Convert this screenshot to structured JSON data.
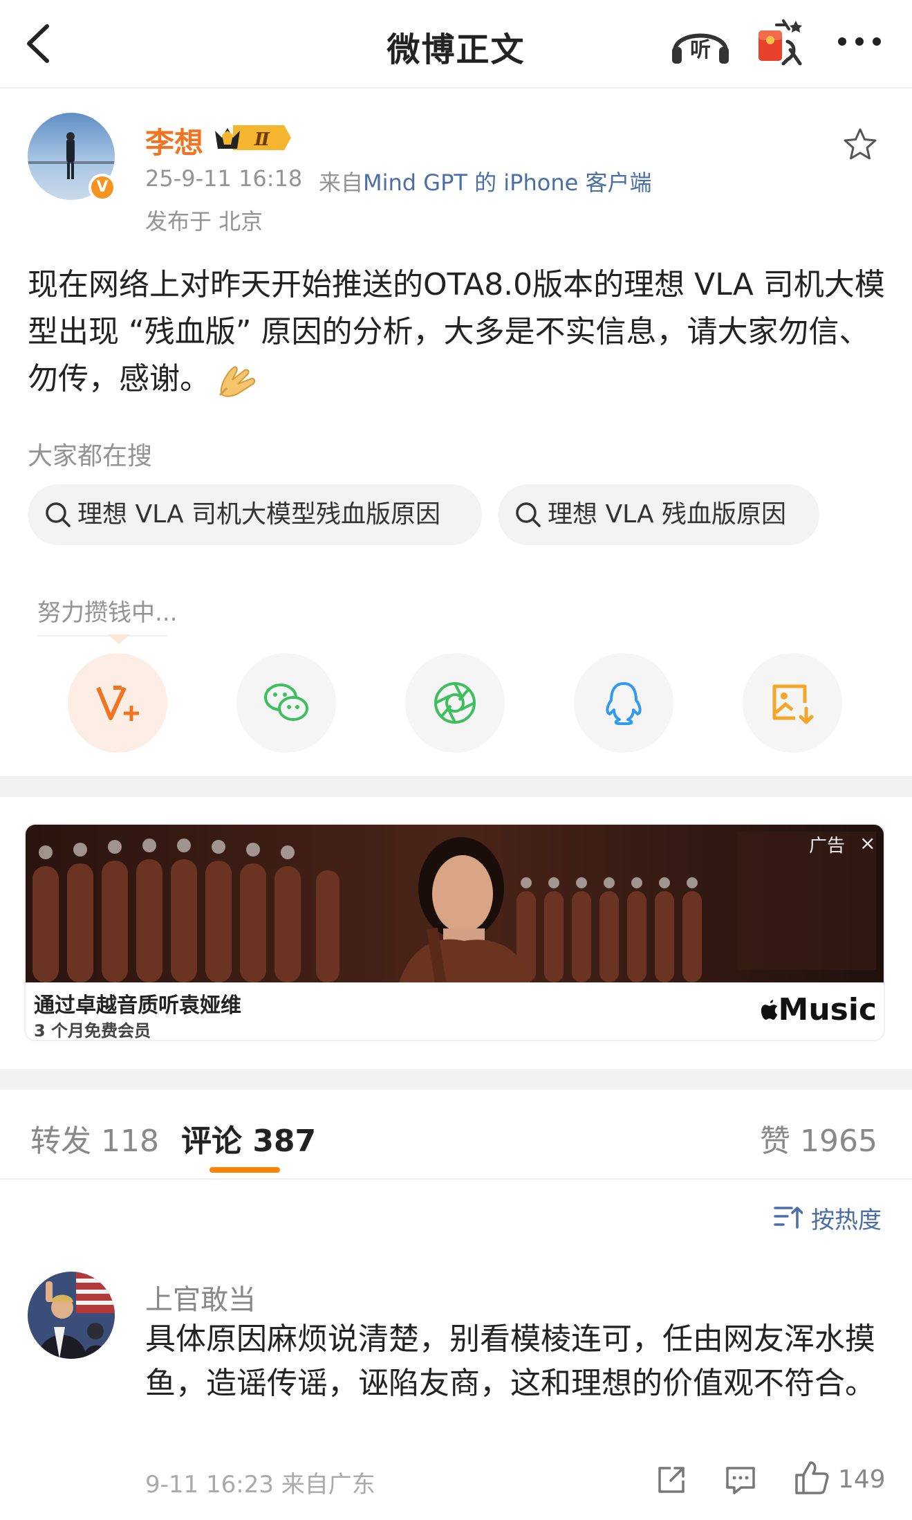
{
  "header": {
    "title": "微博正文",
    "listen_label": "听"
  },
  "post": {
    "author": "李想",
    "member_badge": "Ⅱ",
    "verified_mark": "V",
    "time": "25-9-11 16:18",
    "source_prefix": "来自",
    "source": "Mind GPT 的 iPhone 客户端",
    "location": "发布于 北京",
    "text": "现在网络上对昨天开始推送的OTA8.0版本的理想 VLA 司机大模型出现 “残血版” 原因的分析，大多是不实信息，请大家勿信、勿传，感谢。"
  },
  "search": {
    "label": "大家都在搜",
    "chips": [
      "理想 VLA 司机大模型残血版原因",
      "理想 VLA 残血版原因"
    ]
  },
  "earn": {
    "label": "努力攒钱中..."
  },
  "share_icons": [
    "vplus-icon",
    "wechat-icon",
    "moments-icon",
    "qq-icon",
    "save-image-icon"
  ],
  "ad": {
    "label": "广告",
    "close": "×",
    "title": "通过卓越音质听袁娅维",
    "subtitle": "3 个月免费会员",
    "brand": "Music"
  },
  "tabs": {
    "repost": "转发 118",
    "comment": "评论 387",
    "like": "赞 1965"
  },
  "sort_label": "按热度",
  "comments": [
    {
      "name": "上官敢当",
      "text": "具体原因麻烦说清楚，别看模棱连可，任由网友浑水摸鱼，造谣传谣，诬陷友商，这和理想的价值观不符合。",
      "meta": "9-11 16:23 来自广东",
      "likes": "149"
    }
  ],
  "colors": {
    "accent": "#ff8200",
    "author_name": "#f27420",
    "link": "#4a6ea8"
  }
}
